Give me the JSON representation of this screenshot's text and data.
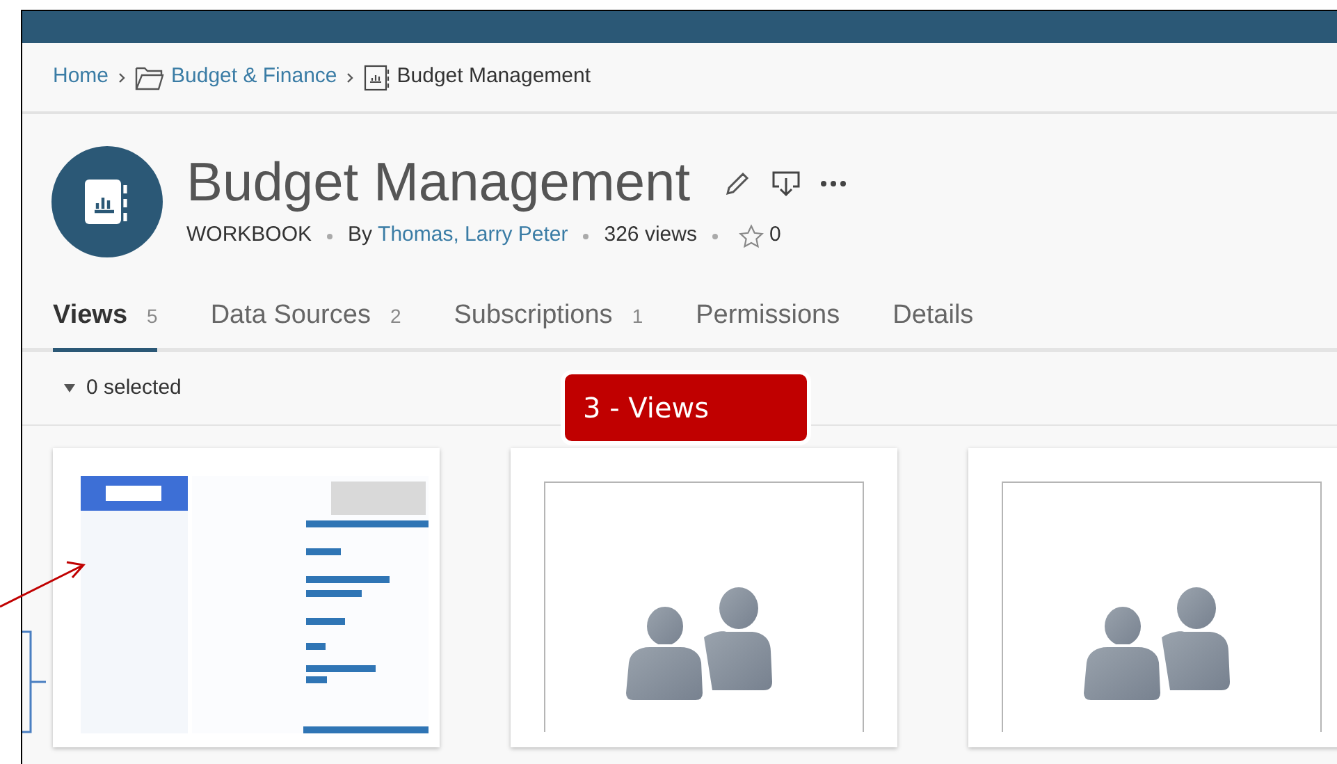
{
  "breadcrumb": [
    {
      "label": "Home",
      "kind": "link"
    },
    {
      "label": "Budget & Finance",
      "kind": "folder"
    },
    {
      "label": "Budget Management",
      "kind": "workbook"
    }
  ],
  "workbook": {
    "title": "Budget Management",
    "type": "WORKBOOK",
    "by": "By",
    "owner": "Thomas, Larry Peter",
    "views": "326 views",
    "favorites": "0"
  },
  "tabs": [
    {
      "label": "Views",
      "count": "5",
      "selected": true
    },
    {
      "label": "Data Sources",
      "count": "2",
      "selected": false
    },
    {
      "label": "Subscriptions",
      "count": "1",
      "selected": false
    },
    {
      "label": "Permissions",
      "selected": false
    },
    {
      "label": "Details",
      "selected": false
    }
  ],
  "selection": {
    "label": "0 selected"
  },
  "callout": {
    "text": "3 - Views"
  },
  "thumbnails": [
    {
      "kind": "picture"
    },
    {
      "kind": "placeholder"
    },
    {
      "kind": "placeholder"
    }
  ]
}
